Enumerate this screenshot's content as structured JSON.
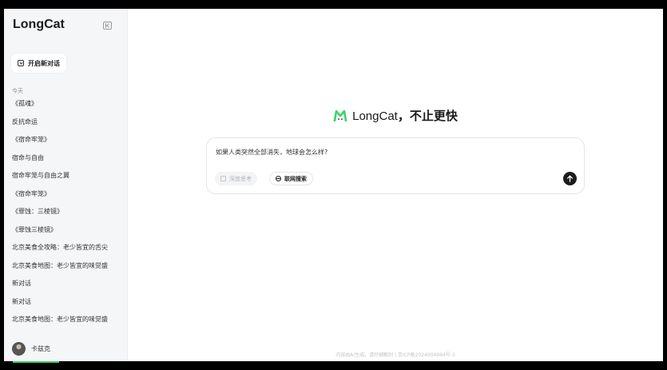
{
  "app": {
    "brand": "LongCat"
  },
  "sidebar": {
    "new_chat_label": "开启新对话",
    "section_label": "今天",
    "history": [
      "《孤魂》",
      "反抗命运",
      "《宿命牢笼》",
      "宿命与自由",
      "宿命牢笼与自由之翼",
      "《宿命牢笼》",
      "《罪蚀：三棱镜》",
      "《罪蚀三棱镜》",
      "北京美食全攻略：老少皆宜的舌尖",
      "北京美食地图：老少皆宜的味觉盛",
      "新对话",
      "新对话",
      "北京美食地图：老少皆宜的味觉盛"
    ],
    "user_name": "卡兹克"
  },
  "main": {
    "hero_brand": "LongCat",
    "hero_slogan": "，不止更快",
    "prompt_text": "如果人类突然全部消失，地球会怎么样?",
    "deep_think_label": "深度思考",
    "web_search_label": "联网搜索",
    "footer": "内容由AI生成，请仔细甄别 | 京ICP备2024004984号-3"
  },
  "colors": {
    "accent": "#3ad46a",
    "send_button": "#1c1c1c"
  },
  "icons": [
    "collapse-sidebar-icon",
    "new-chat-icon",
    "longcat-logo-icon",
    "deep-think-icon",
    "globe-icon",
    "arrow-up-icon"
  ]
}
